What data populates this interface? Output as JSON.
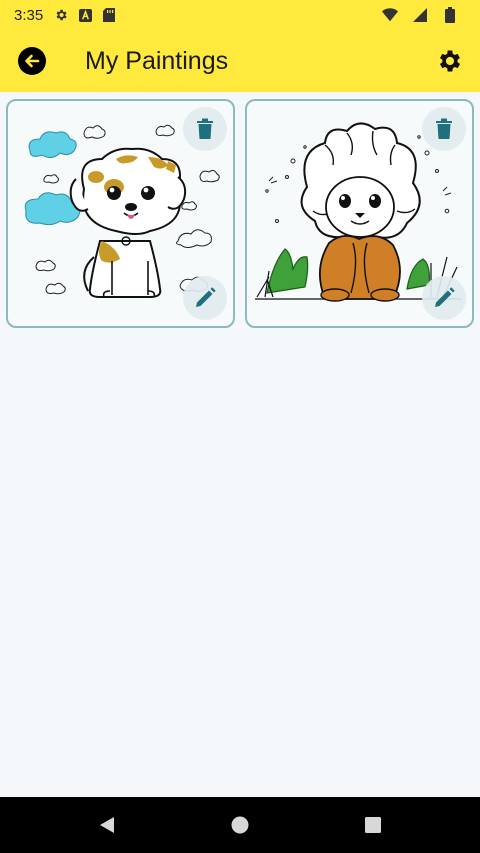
{
  "status_bar": {
    "time": "3:35",
    "icons": [
      "settings-icon",
      "font-a-icon",
      "sd-card-icon",
      "wifi-icon",
      "signal-icon",
      "battery-icon"
    ]
  },
  "app_bar": {
    "title": "My Paintings",
    "background": "#ffe93d",
    "back_icon": "arrow-left-circle-icon",
    "settings_icon": "gear-icon"
  },
  "paintings": [
    {
      "subject": "puppy",
      "delete_icon": "trash-icon",
      "edit_icon": "pencil-icon",
      "fill_colors": [
        "#c89a2a",
        "#5fd0e6"
      ]
    },
    {
      "subject": "lion cub",
      "delete_icon": "trash-icon",
      "edit_icon": "pencil-icon",
      "fill_colors": [
        "#cf7f26",
        "#3fa13a"
      ]
    }
  ],
  "colors": {
    "accent_icon": "#1f6f7c",
    "card_border": "#8fb8bf",
    "page_bg": "#f4f8fa"
  },
  "nav_bar": {
    "icons": [
      "triangle-back-icon",
      "circle-home-icon",
      "square-recents-icon"
    ]
  }
}
